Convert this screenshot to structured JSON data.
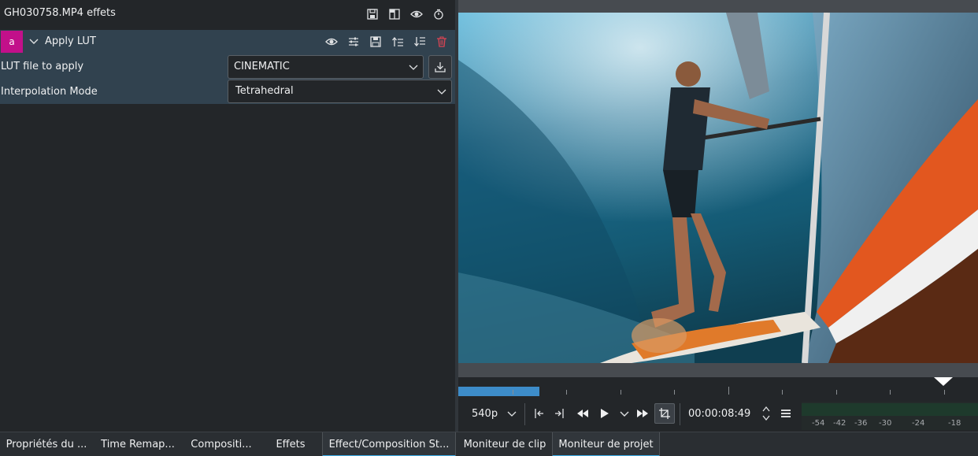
{
  "effects_panel": {
    "title": "GH030758.MP4 effets",
    "header_icons": [
      "save-preset-icon",
      "split-compare-icon",
      "eye-icon",
      "timer-icon"
    ],
    "effect": {
      "badge": "a",
      "name": "Apply LUT",
      "icons": [
        "eye-icon",
        "sliders-icon",
        "save-icon",
        "move-up-icon",
        "move-down-icon",
        "delete-icon"
      ],
      "params": [
        {
          "label": "LUT file to apply",
          "value": "CINEMATIC"
        },
        {
          "label": "Interpolation Mode",
          "value": "Tetrahedral"
        }
      ]
    }
  },
  "monitor": {
    "zoom": "540p",
    "timecode": "00:00:08:49",
    "audio_meter_labels": [
      "-54",
      "-42",
      "-36",
      "-30",
      "-24",
      "-18"
    ],
    "colors": {
      "zone": "#3d8cc9",
      "badge": "#c2108a",
      "accent": "#3daee9"
    }
  },
  "tabs": [
    {
      "label": "Propriétés du ..."
    },
    {
      "label": "Time Remap..."
    },
    {
      "label": "Compositi..."
    },
    {
      "label": "Effets"
    },
    {
      "label": "Effect/Composition St..."
    },
    {
      "label": "Moniteur de clip"
    },
    {
      "label": "Moniteur de projet"
    }
  ]
}
